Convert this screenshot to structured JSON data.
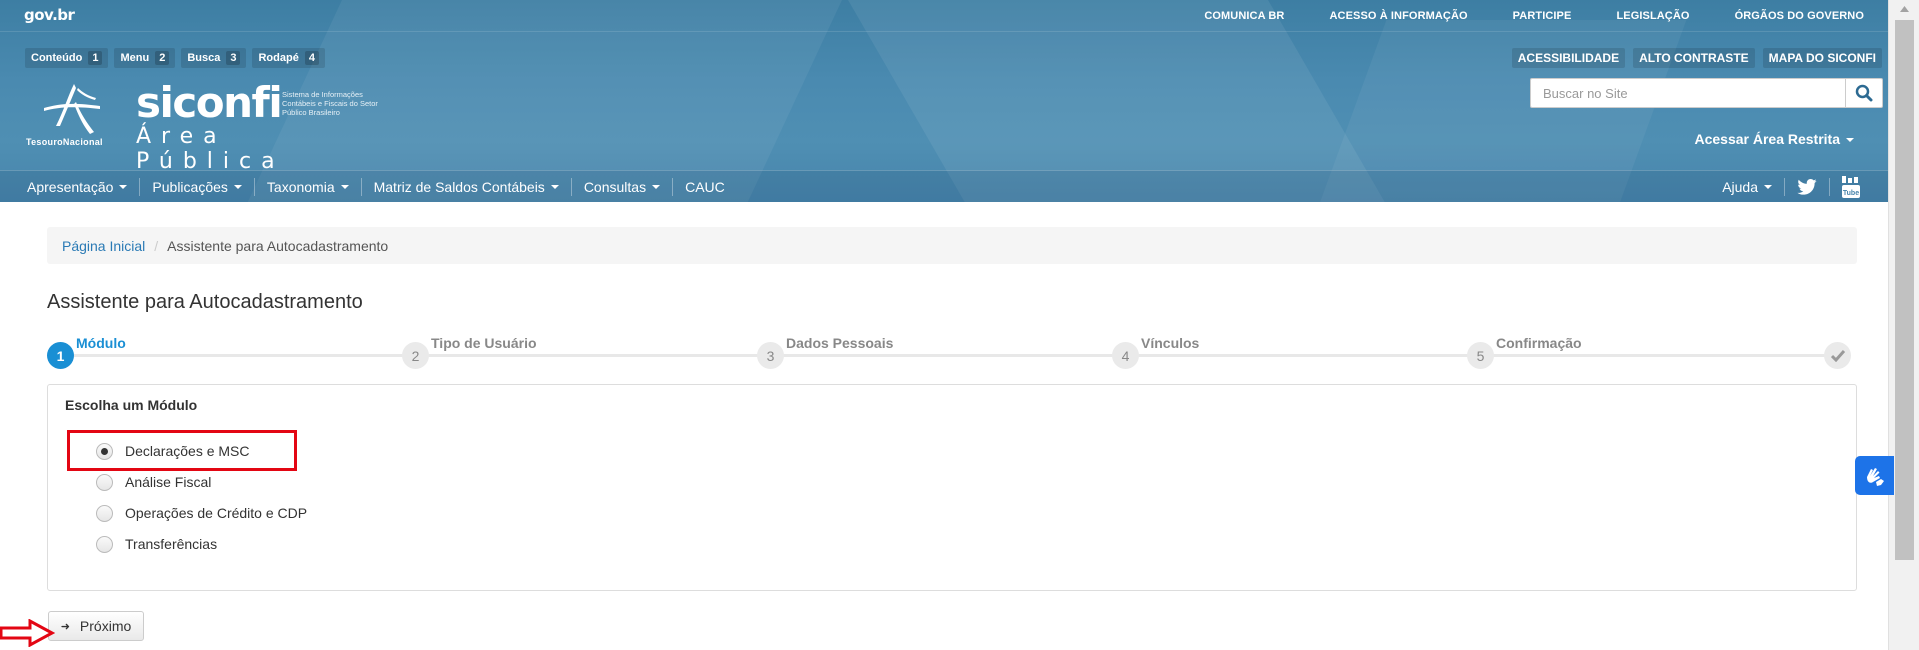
{
  "gov": {
    "logo": "gov.br",
    "links": [
      "COMUNICA BR",
      "ACESSO À INFORMAÇÃO",
      "PARTICIPE",
      "LEGISLAÇÃO",
      "ÓRGÃOS DO GOVERNO"
    ]
  },
  "skip_links": [
    {
      "label": "Conteúdo",
      "key": "1"
    },
    {
      "label": "Menu",
      "key": "2"
    },
    {
      "label": "Busca",
      "key": "3"
    },
    {
      "label": "Rodapé",
      "key": "4"
    }
  ],
  "accessibility_links": [
    "ACESSIBILIDADE",
    "ALTO CONTRASTE",
    "MAPA DO SICONFI"
  ],
  "brand": {
    "tesouro": "TesouroNacional",
    "name": "siconfi",
    "subtitle": "Sistema de Informações Contábeis e Fiscais do Setor Público Brasileiro",
    "area": "Área Pública"
  },
  "search": {
    "placeholder": "Buscar no Site"
  },
  "restricted_area": "Acessar Área Restrita",
  "nav": {
    "items": [
      "Apresentação",
      "Publicações",
      "Taxonomia",
      "Matriz de Saldos Contábeis",
      "Consultas"
    ],
    "cauc": "CAUC",
    "help": "Ajuda"
  },
  "breadcrumb": {
    "home": "Página Inicial",
    "current": "Assistente para Autocadastramento"
  },
  "page_title": "Assistente para Autocadastramento",
  "steps": [
    {
      "num": "1",
      "label": "Módulo"
    },
    {
      "num": "2",
      "label": "Tipo de Usuário"
    },
    {
      "num": "3",
      "label": "Dados Pessoais"
    },
    {
      "num": "4",
      "label": "Vínculos"
    },
    {
      "num": "5",
      "label": "Confirmação"
    }
  ],
  "active_step": 1,
  "panel": {
    "title": "Escolha um Módulo",
    "options": [
      "Declarações e MSC",
      "Análise Fiscal",
      "Operações de Crédito e CDP",
      "Transferências"
    ],
    "selected_option": "Declarações e MSC"
  },
  "next_button": "Próximo",
  "colors": {
    "accent": "#1a8fd4",
    "header": "#4a8ab0",
    "highlight": "#e30613",
    "libras": "#1d73e8"
  }
}
